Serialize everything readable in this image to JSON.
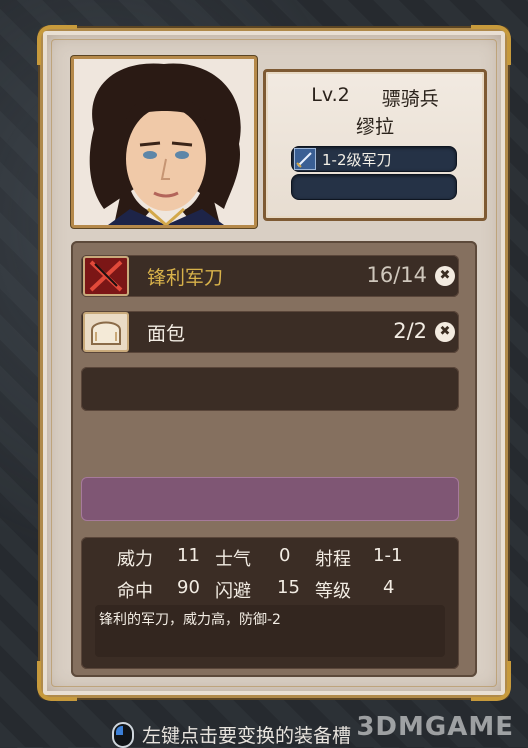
{
  "unit": {
    "level": "Lv.2",
    "class": "骠骑兵",
    "name": "缪拉",
    "equipped_slots": [
      {
        "label": "1-2级军刀",
        "icon": "saber-icon"
      },
      {
        "label": "",
        "icon": ""
      }
    ]
  },
  "inventory": {
    "items": [
      {
        "name": "锋利军刀",
        "count": "16/14",
        "icon": "crossed-sabers-icon",
        "remove_icon": "close-icon",
        "remove_glyph": "✖"
      },
      {
        "name": "面包",
        "count": "2/2",
        "icon": "bread-icon",
        "remove_icon": "close-icon",
        "remove_glyph": "✖"
      }
    ]
  },
  "stats": {
    "row1": [
      {
        "label": "威力",
        "value": "11"
      },
      {
        "label": "士气",
        "value": "0"
      },
      {
        "label": "射程",
        "value": "1-1"
      }
    ],
    "row2": [
      {
        "label": "命中",
        "value": "90"
      },
      {
        "label": "闪避",
        "value": "15"
      },
      {
        "label": "等级",
        "value": "4"
      }
    ],
    "description": "锋利的军刀，威力高，防御-2"
  },
  "footer": {
    "hint": "左键点击要变换的装备槽",
    "icon": "mouse-left-click-icon"
  },
  "watermark": "3DMGAME",
  "colors": {
    "panel": "#d9cfc4",
    "gold": "#b08a4a",
    "selected_item_text": "#d8b24a",
    "highlight_bar": "#7f5674",
    "slot_blue": "#253246"
  }
}
